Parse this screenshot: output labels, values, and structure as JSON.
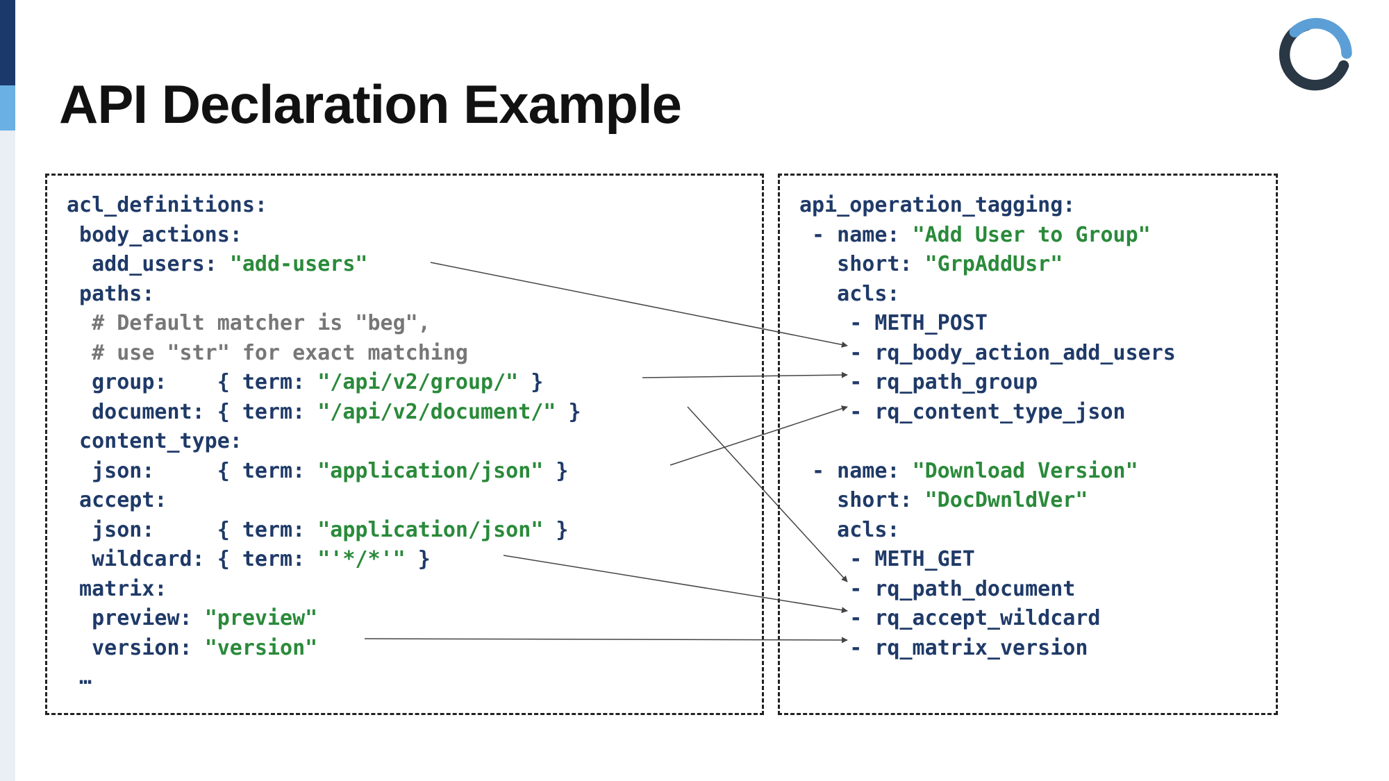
{
  "title": "API Declaration Example",
  "left": {
    "l00": "acl_definitions:",
    "l01": " body_actions:",
    "l02_pre": "  add_users: ",
    "l02_str": "\"add-users\"",
    "l03": " paths:",
    "l04": "  # Default matcher is \"beg\",",
    "l05": "  # use \"str\" for exact matching",
    "l06_pre": "  group:    { term: ",
    "l06_str": "\"/api/v2/group/\"",
    "l06_post": " }",
    "l07_pre": "  document: { term: ",
    "l07_str": "\"/api/v2/document/\"",
    "l07_post": " }",
    "l08": " content_type:",
    "l09_pre": "  json:     { term: ",
    "l09_str": "\"application/json\"",
    "l09_post": " }",
    "l10": " accept:",
    "l11_pre": "  json:     { term: ",
    "l11_str": "\"application/json\"",
    "l11_post": " }",
    "l12_pre": "  wildcard: { term: ",
    "l12_str": "\"'*/*'\"",
    "l12_post": " }",
    "l13": " matrix:",
    "l14_pre": "  preview: ",
    "l14_str": "\"preview\"",
    "l15_pre": "  version: ",
    "l15_str": "\"version\"",
    "l16": " …"
  },
  "right": {
    "r00": "api_operation_tagging:",
    "r01_pre": " - name: ",
    "r01_str": "\"Add User to Group\"",
    "r02_pre": "   short: ",
    "r02_str": "\"GrpAddUsr\"",
    "r03": "   acls:",
    "r04": "    - METH_POST",
    "r05": "    - rq_body_action_add_users",
    "r06": "    - rq_path_group",
    "r07": "    - rq_content_type_json",
    "r08": "",
    "r09_pre": " - name: ",
    "r09_str": "\"Download Version\"",
    "r10_pre": "   short: ",
    "r10_str": "\"DocDwnldVer\"",
    "r11": "   acls:",
    "r12": "    - METH_GET",
    "r13": "    - rq_path_document",
    "r14": "    - rq_accept_wildcard",
    "r15": "    - rq_matrix_version"
  }
}
